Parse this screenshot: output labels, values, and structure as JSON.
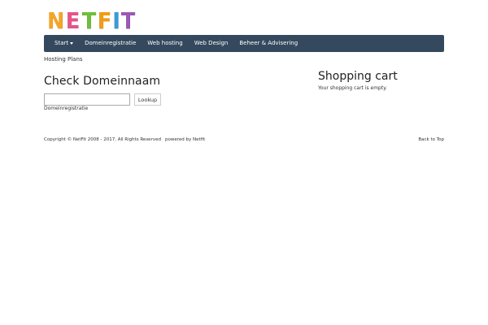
{
  "logo": {
    "letters": [
      {
        "char": "N",
        "color": "#f5a623"
      },
      {
        "char": "E",
        "color": "#e8548a"
      },
      {
        "char": "T",
        "color": "#6fbf3a"
      },
      {
        "char": "F",
        "color": "#f39c12"
      },
      {
        "char": "I",
        "color": "#3a9ad9"
      },
      {
        "char": "T",
        "color": "#9b59b6"
      }
    ]
  },
  "nav": {
    "items": [
      {
        "label": "Start",
        "has_dropdown": true
      },
      {
        "label": "Domeinregistratie"
      },
      {
        "label": "Web hosting"
      },
      {
        "label": "Web Design"
      },
      {
        "label": "Beheer & Advisering"
      }
    ],
    "background": "#34495e"
  },
  "breadcrumb": "Hosting Plans",
  "main": {
    "heading": "Check Domeinnaam",
    "input_value": "",
    "lookup_label": "Lookup",
    "link_label": "Domeinregistratie"
  },
  "cart": {
    "heading": "Shopping cart",
    "empty_text": "Your shopping cart is empty."
  },
  "footer": {
    "copyright": "Copyright © NetFit 2008 - 2017, All Rights Reserved",
    "powered": "powered by Netfit",
    "back_to_top": "Back to Top"
  }
}
